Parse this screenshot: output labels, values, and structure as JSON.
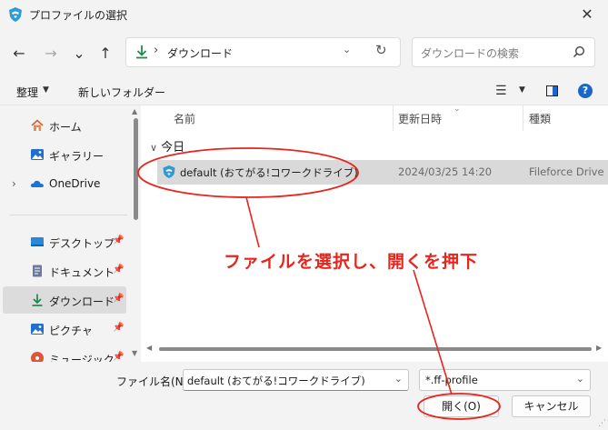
{
  "window": {
    "title": "プロファイルの選択"
  },
  "nav": {
    "back": "←",
    "forward": "→",
    "recent": "⌄",
    "up": "↑"
  },
  "address": {
    "separator": "›",
    "location": "ダウンロード"
  },
  "search": {
    "placeholder": "ダウンロードの検索"
  },
  "toolbar": {
    "organize": "整理",
    "new_folder": "新しいフォルダー"
  },
  "sidebar": {
    "items": [
      {
        "label": "ホーム",
        "icon": "home-icon"
      },
      {
        "label": "ギャラリー",
        "icon": "gallery-icon"
      },
      {
        "label": "OneDrive",
        "icon": "onedrive-icon"
      },
      {
        "label": "デスクトップ",
        "icon": "desktop-icon",
        "pinned": true
      },
      {
        "label": "ドキュメント",
        "icon": "documents-icon",
        "pinned": true
      },
      {
        "label": "ダウンロード",
        "icon": "download-icon",
        "pinned": true,
        "selected": true
      },
      {
        "label": "ピクチャ",
        "icon": "pictures-icon",
        "pinned": true
      },
      {
        "label": "ミュージック",
        "icon": "music-icon",
        "pinned": true
      }
    ]
  },
  "columns": {
    "name": "名前",
    "date": "更新日時",
    "type": "種類"
  },
  "group": {
    "label": "今日"
  },
  "file": {
    "name": "default (おてがる!コワークドライブ)",
    "date": "2024/03/25 14:20",
    "type": "Fileforce Drive P"
  },
  "bottom": {
    "filename_label": "ファイル名(N):",
    "filename_value": "default (おてがる!コワークドライブ)",
    "filetype_value": "*.ff-profile",
    "open_label": "開く(O)",
    "cancel_label": "キャンセル"
  },
  "annotation": {
    "text": "ファイルを選択し、開くを押下",
    "color": "#e8241d"
  },
  "colors": {
    "accent": "#1a66c9",
    "selection": "#d9d9d9",
    "annotation": "#e8241d"
  }
}
